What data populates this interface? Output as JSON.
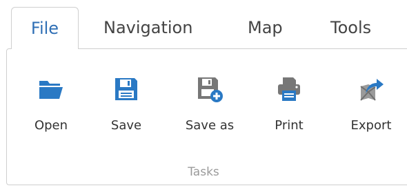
{
  "tabs": [
    {
      "label": "File",
      "active": true
    },
    {
      "label": "Navigation",
      "active": false
    },
    {
      "label": "Map",
      "active": false
    },
    {
      "label": "Tools",
      "active": false
    }
  ],
  "ribbon": {
    "group_label": "Tasks",
    "buttons": [
      {
        "label": "Open",
        "icon": "folder-open-icon"
      },
      {
        "label": "Save",
        "icon": "floppy-disk-icon"
      },
      {
        "label": "Save as",
        "icon": "save-as-icon"
      },
      {
        "label": "Print",
        "icon": "printer-icon"
      },
      {
        "label": "Export",
        "icon": "export-icon"
      }
    ]
  },
  "colors": {
    "accent": "#2f6fb5",
    "icon_blue": "#2a79c4",
    "icon_gray": "#777777",
    "border": "#cfcfcf"
  }
}
